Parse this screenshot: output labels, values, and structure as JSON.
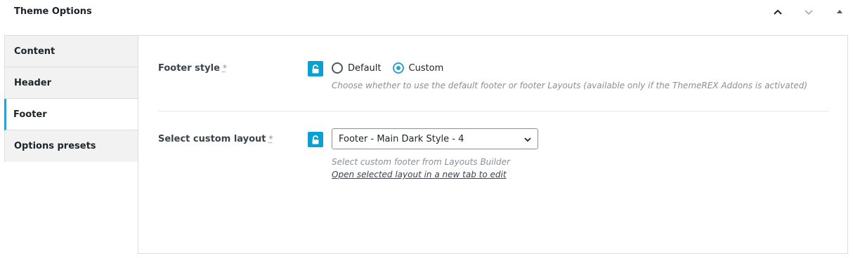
{
  "header": {
    "title": "Theme Options",
    "buttons": [
      {
        "name": "move-up-icon"
      },
      {
        "name": "move-down-icon"
      },
      {
        "name": "toggle-panel-icon"
      }
    ]
  },
  "sidebar": {
    "tabs": [
      {
        "label": "Content",
        "active": false
      },
      {
        "label": "Header",
        "active": false
      },
      {
        "label": "Footer",
        "active": true
      },
      {
        "label": "Options presets",
        "active": false
      }
    ]
  },
  "footer_style": {
    "label": "Footer style",
    "required_mark": "*",
    "options": [
      {
        "label": "Default",
        "checked": false
      },
      {
        "label": "Custom",
        "checked": true
      }
    ],
    "description": "Choose whether to use the default footer or footer Layouts (available only if the ThemeREX Addons is activated)"
  },
  "custom_layout": {
    "label": "Select custom layout",
    "required_mark": "*",
    "selected": "Footer - Main Dark Style - 4",
    "description": "Select custom footer from Layouts Builder",
    "link_text": "Open selected layout in a new tab to edit"
  },
  "colors": {
    "accent": "#2ea2cc",
    "lock": "#0aa0d2"
  }
}
